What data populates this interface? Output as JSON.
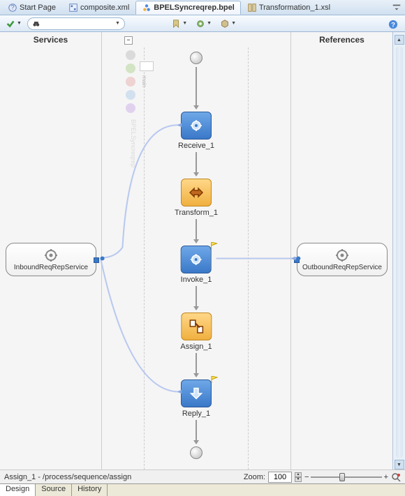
{
  "tabs": [
    {
      "label": "Start Page",
      "icon": "help-icon",
      "active": false
    },
    {
      "label": "composite.xml",
      "icon": "xml-file-icon",
      "active": false
    },
    {
      "label": "BPELSyncreqrep.bpel",
      "icon": "bpel-file-icon",
      "active": true
    },
    {
      "label": "Transformation_1.xsl",
      "icon": "xsl-file-icon",
      "active": false
    }
  ],
  "toolbar": {
    "verify_icon": "check-icon",
    "search_icon": "binoculars-icon",
    "search_placeholder": "",
    "bookmark_icon": "bookmark-icon",
    "gear_icon": "gear-icon",
    "box_icon": "box-icon",
    "help_icon": "help-icon"
  },
  "headers": {
    "services": "Services",
    "references": "References"
  },
  "palette_label": "BPELSyncreqrep",
  "mini_label": "main",
  "collapse": "−",
  "nodes": {
    "receive": {
      "label": "Receive_1",
      "icon": "gear-icon"
    },
    "transform": {
      "label": "Transform_1",
      "icon": "transform-icon"
    },
    "invoke": {
      "label": "Invoke_1",
      "icon": "gear-icon",
      "flag": true
    },
    "assign": {
      "label": "Assign_1",
      "icon": "assign-icon"
    },
    "reply": {
      "label": "Reply_1",
      "icon": "reply-icon",
      "flag": true
    }
  },
  "services": {
    "inbound": {
      "label": "InboundReqRepService",
      "icon": "gear-icon"
    },
    "outbound": {
      "label": "OutboundReqRepService",
      "icon": "gear-icon"
    }
  },
  "status": {
    "selection": "Assign_1 - /process/sequence/assign",
    "zoom_label": "Zoom:",
    "zoom_value": "100"
  },
  "bottom_tabs": [
    {
      "label": "Design",
      "active": true
    },
    {
      "label": "Source",
      "active": false
    },
    {
      "label": "History",
      "active": false
    }
  ]
}
